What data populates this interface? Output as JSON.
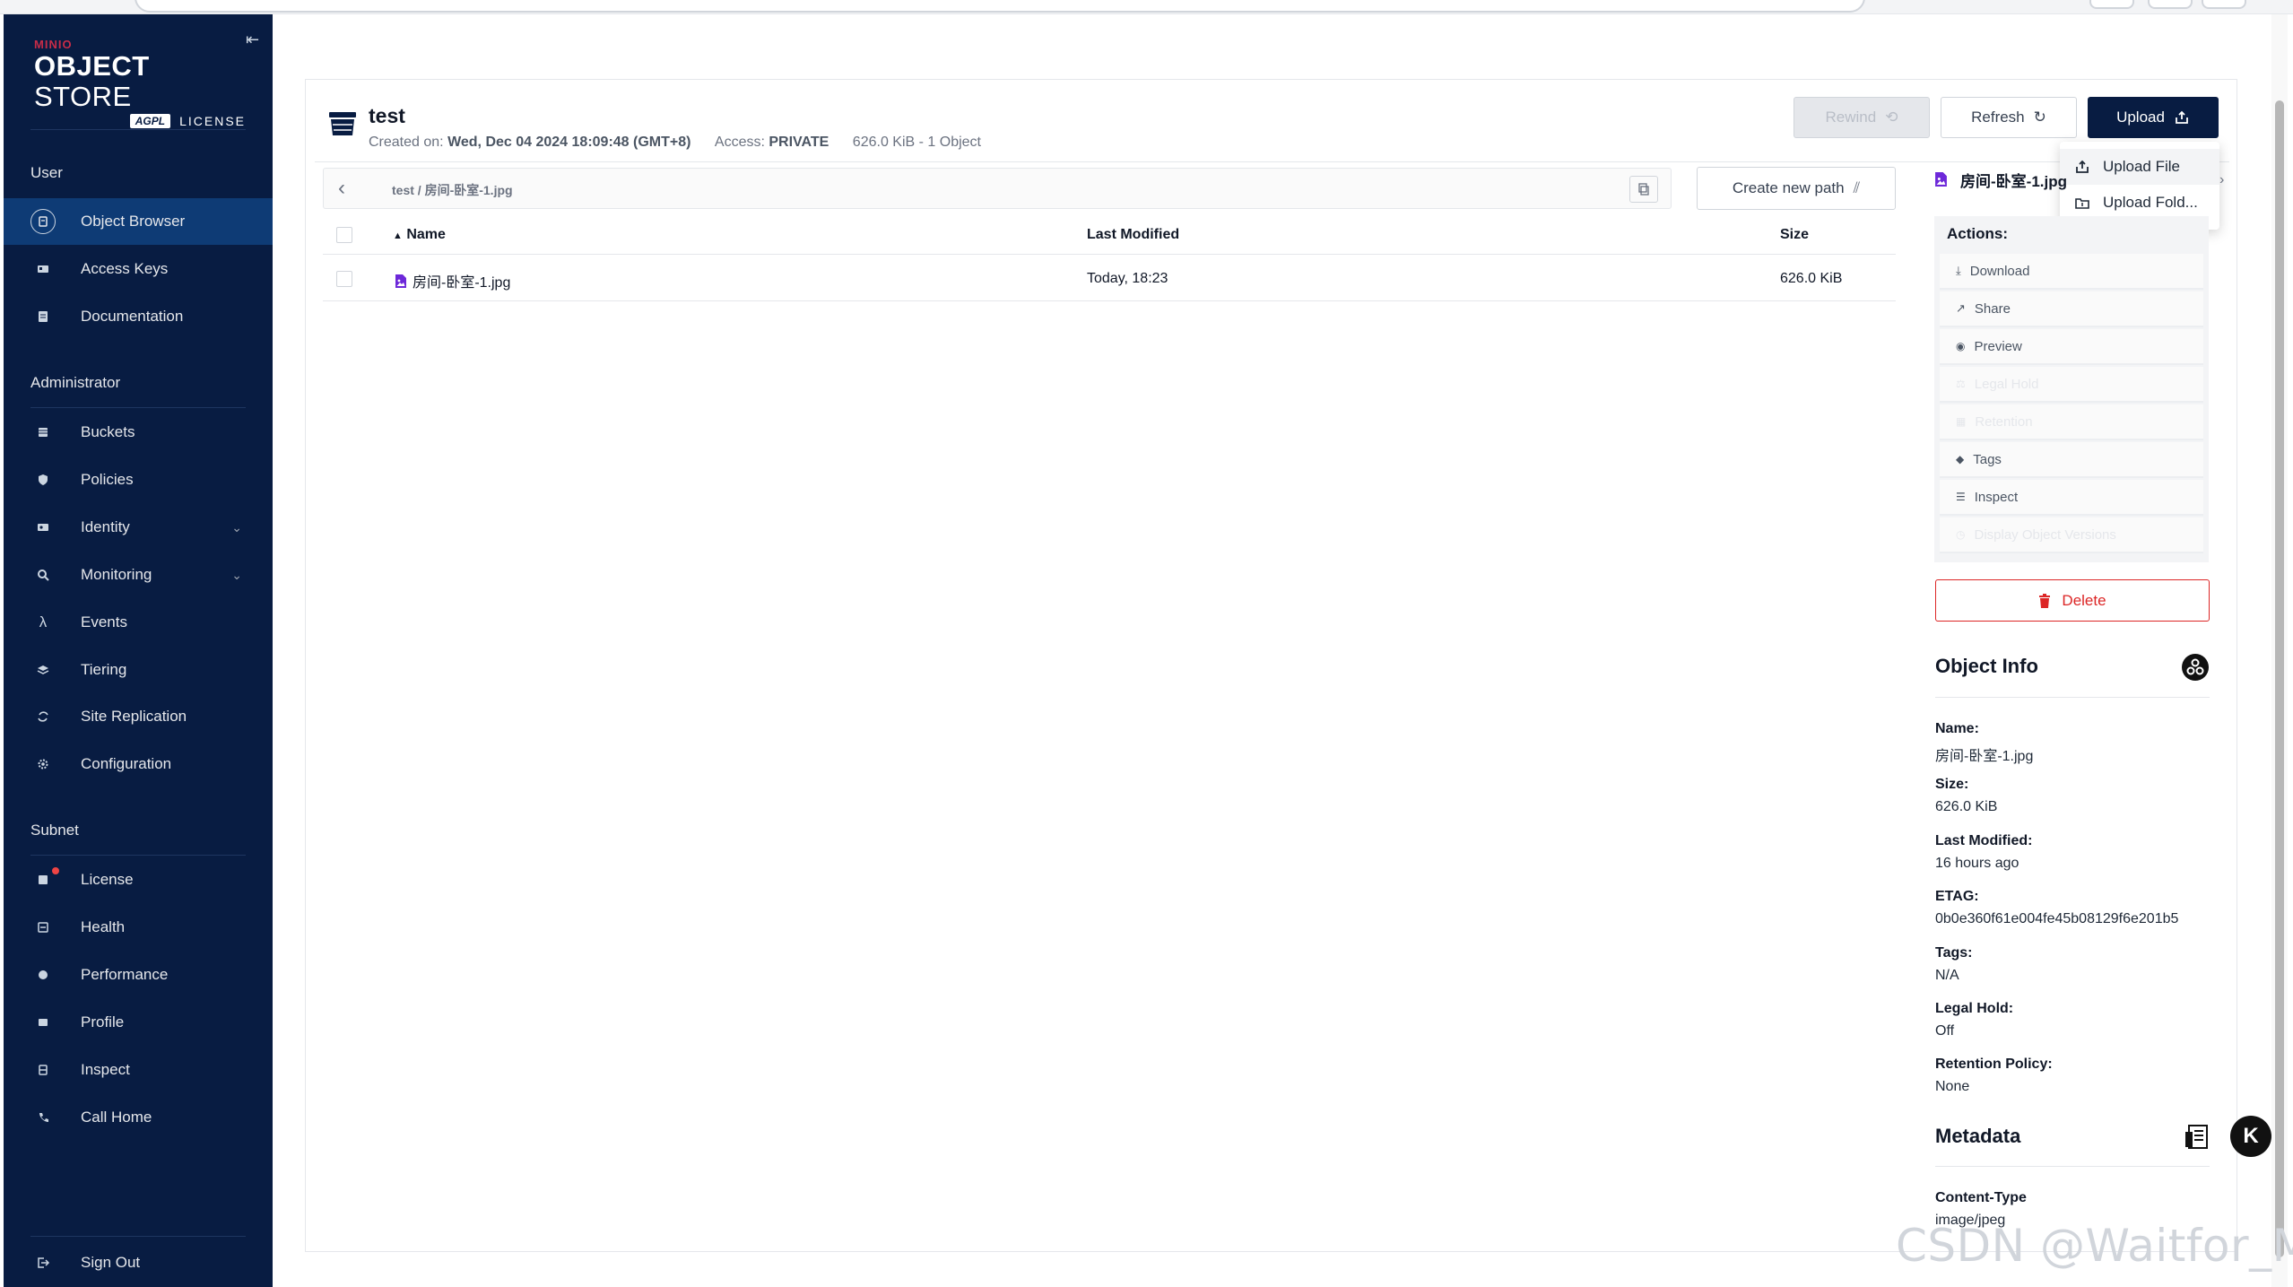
{
  "app": {
    "brand_small": "MINIO",
    "brand_main_bold": "OBJECT",
    "brand_main_thin": "STORE",
    "license_badge": "AGPL",
    "license_word": "LICENSE"
  },
  "sidebar": {
    "sections": [
      {
        "title": "User",
        "items": [
          {
            "label": "Object Browser",
            "icon": "object-browser-icon",
            "active": true
          },
          {
            "label": "Access Keys",
            "icon": "access-keys-icon"
          },
          {
            "label": "Documentation",
            "icon": "documentation-icon"
          }
        ]
      },
      {
        "title": "Administrator",
        "items": [
          {
            "label": "Buckets",
            "icon": "buckets-icon"
          },
          {
            "label": "Policies",
            "icon": "policies-icon"
          },
          {
            "label": "Identity",
            "icon": "identity-icon",
            "expandable": true
          },
          {
            "label": "Monitoring",
            "icon": "monitoring-icon",
            "expandable": true
          },
          {
            "label": "Events",
            "icon": "lambda-icon"
          },
          {
            "label": "Tiering",
            "icon": "tiering-icon"
          },
          {
            "label": "Site Replication",
            "icon": "site-replication-icon"
          },
          {
            "label": "Configuration",
            "icon": "gear-icon"
          }
        ]
      },
      {
        "title": "Subnet",
        "items": [
          {
            "label": "License",
            "icon": "license-icon",
            "badge": true
          },
          {
            "label": "Health",
            "icon": "health-icon"
          },
          {
            "label": "Performance",
            "icon": "performance-icon"
          },
          {
            "label": "Profile",
            "icon": "profile-icon"
          },
          {
            "label": "Inspect",
            "icon": "inspect-icon"
          },
          {
            "label": "Call Home",
            "icon": "call-home-icon"
          }
        ]
      }
    ],
    "sign_out": "Sign Out"
  },
  "bucket": {
    "name": "test",
    "created_label": "Created on:",
    "created_value": "Wed, Dec 04 2024 18:09:48 (GMT+8)",
    "access_label": "Access:",
    "access_value": "PRIVATE",
    "summary": "626.0 KiB - 1 Object"
  },
  "toolbar": {
    "rewind": "Rewind",
    "refresh": "Refresh",
    "upload": "Upload",
    "upload_menu": [
      "Upload File",
      "Upload Fold..."
    ]
  },
  "path": {
    "crumb": "test / 房间-卧室-1.jpg",
    "create_new_path": "Create new path"
  },
  "table": {
    "columns": [
      "Name",
      "Last Modified",
      "Size"
    ],
    "rows": [
      {
        "name": "房间-卧室-1.jpg",
        "modified": "Today, 18:23",
        "size": "626.0 KiB"
      }
    ]
  },
  "panel": {
    "file_name": "房间-卧室-1.jpg",
    "actions_title": "Actions:",
    "actions": [
      {
        "label": "Download",
        "icon": "download-icon",
        "enabled": true
      },
      {
        "label": "Share",
        "icon": "share-icon",
        "enabled": true
      },
      {
        "label": "Preview",
        "icon": "eye-icon",
        "enabled": true
      },
      {
        "label": "Legal Hold",
        "icon": "legal-hold-icon",
        "enabled": false
      },
      {
        "label": "Retention",
        "icon": "retention-icon",
        "enabled": false
      },
      {
        "label": "Tags",
        "icon": "tag-icon",
        "enabled": true
      },
      {
        "label": "Inspect",
        "icon": "inspect-icon",
        "enabled": true
      },
      {
        "label": "Display Object Versions",
        "icon": "versions-icon",
        "enabled": false
      }
    ],
    "delete": "Delete",
    "object_info_title": "Object Info",
    "info": [
      {
        "label": "Name:",
        "value": "房间-卧室-1.jpg"
      },
      {
        "label": "Size:",
        "value": "626.0 KiB"
      },
      {
        "label": "Last Modified:",
        "value": "16 hours ago"
      },
      {
        "label": "ETAG:",
        "value": "0b0e360f61e004fe45b08129f6e201b5"
      },
      {
        "label": "Tags:",
        "value": "N/A"
      },
      {
        "label": "Legal Hold:",
        "value": "Off"
      },
      {
        "label": "Retention Policy:",
        "value": "None"
      }
    ],
    "metadata_title": "Metadata",
    "metadata": [
      {
        "label": "Content-Type",
        "value": "image/jpeg"
      }
    ]
  },
  "floating_button": "K",
  "watermark": "CSDN @Waitfor_Me",
  "colors": {
    "sidebar_bg": "#081c42",
    "sidebar_active": "#0e3b75",
    "primary": "#081c42",
    "danger": "#dc2626",
    "file_icon": "#6d28d9"
  }
}
